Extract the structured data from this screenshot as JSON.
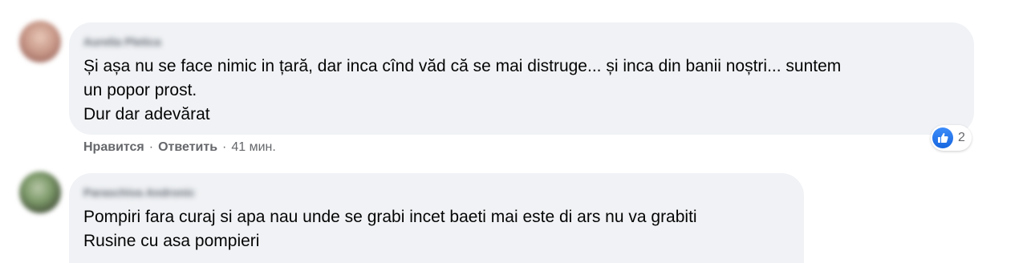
{
  "comments": [
    {
      "author": "Aurelia Pletica",
      "lines": [
        "Și așa nu se face nimic in țară, dar inca cînd văd că se mai distruge... și inca din banii noștri... suntem",
        "un popor prost.",
        "Dur dar adevărat"
      ],
      "actions": {
        "like": "Нравится",
        "reply": "Ответить",
        "time": "41 мин."
      },
      "reactions": {
        "icon": "thumbs-up-icon",
        "count": "2",
        "color": "#1877f2"
      }
    },
    {
      "author": "Paraschiva Andronic",
      "lines": [
        "Pompiri fara curaj si apa nau unde se grabi incet baeti mai este di ars nu va grabiti",
        "Rusine cu asa pompieri"
      ]
    }
  ]
}
